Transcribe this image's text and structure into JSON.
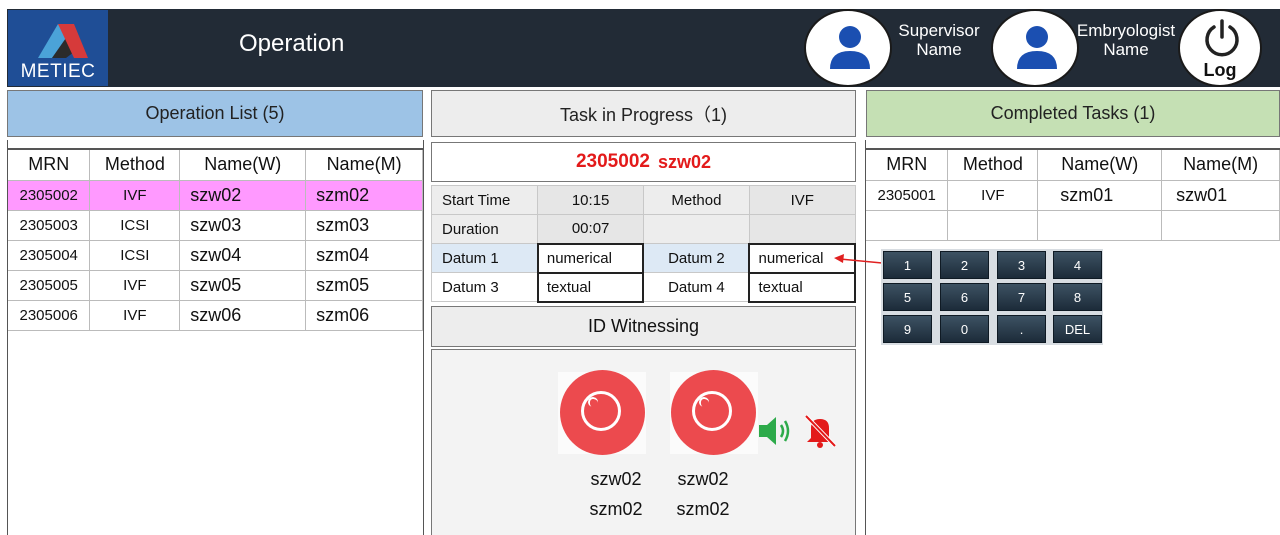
{
  "header": {
    "logo_text": "METIEC",
    "title": "Operation",
    "supervisor": {
      "line1": "Supervisor",
      "line2": "Name"
    },
    "embryologist": {
      "line1": "Embryologist",
      "line2": "Name"
    },
    "log_label": "Log"
  },
  "operation_list": {
    "title": "Operation List (5)",
    "columns": [
      "MRN",
      "Method",
      "Name(W)",
      "Name(M)"
    ],
    "rows": [
      {
        "mrn": "2305002",
        "method": "IVF",
        "name_w": "szw02",
        "name_m": "szm02",
        "selected": true
      },
      {
        "mrn": "2305003",
        "method": "ICSI",
        "name_w": "szw03",
        "name_m": "szm03"
      },
      {
        "mrn": "2305004",
        "method": "ICSI",
        "name_w": "szw04",
        "name_m": "szm04"
      },
      {
        "mrn": "2305005",
        "method": "IVF",
        "name_w": "szw05",
        "name_m": "szm05"
      },
      {
        "mrn": "2305006",
        "method": "IVF",
        "name_w": "szw06",
        "name_m": "szm06"
      }
    ]
  },
  "task": {
    "title": "Task in Progress（1)",
    "mrn": "2305002",
    "name": "szw02",
    "start_time_label": "Start Time",
    "start_time": "10:15",
    "method_label": "Method",
    "method": "IVF",
    "duration_label": "Duration",
    "duration": "00:07",
    "datum1_label": "Datum 1",
    "datum1_value": "numerical",
    "datum2_label": "Datum 2",
    "datum2_value": "numerical",
    "datum3_label": "Datum 3",
    "datum3_value": "textual",
    "datum4_label": "Datum 4",
    "datum4_value": "textual"
  },
  "id_witnessing": {
    "title": "ID Witnessing",
    "left": {
      "line1": "szw02",
      "line2": "szm02"
    },
    "right": {
      "line1": "szw02",
      "line2": "szm02"
    }
  },
  "completed": {
    "title": "Completed Tasks (1)",
    "columns": [
      "MRN",
      "Method",
      "Name(W)",
      "Name(M)"
    ],
    "rows": [
      {
        "mrn": "2305001",
        "method": "IVF",
        "name_w": "szm01",
        "name_m": "szw01"
      }
    ]
  },
  "keypad": {
    "keys": [
      "1",
      "2",
      "3",
      "4",
      "5",
      "6",
      "7",
      "8",
      "9",
      "0",
      ".",
      "DEL"
    ]
  },
  "colors": {
    "header_bg": "#222b36",
    "logo_bg": "#1f4e96",
    "ops_header": "#9dc3e6",
    "completed_header": "#c5e0b4",
    "selected_row": "#ff99ff",
    "task_id": "#e31a1a",
    "record_button": "#ec4a4e",
    "speaker": "#2daa4a",
    "mute_bell": "#e31a1a"
  }
}
